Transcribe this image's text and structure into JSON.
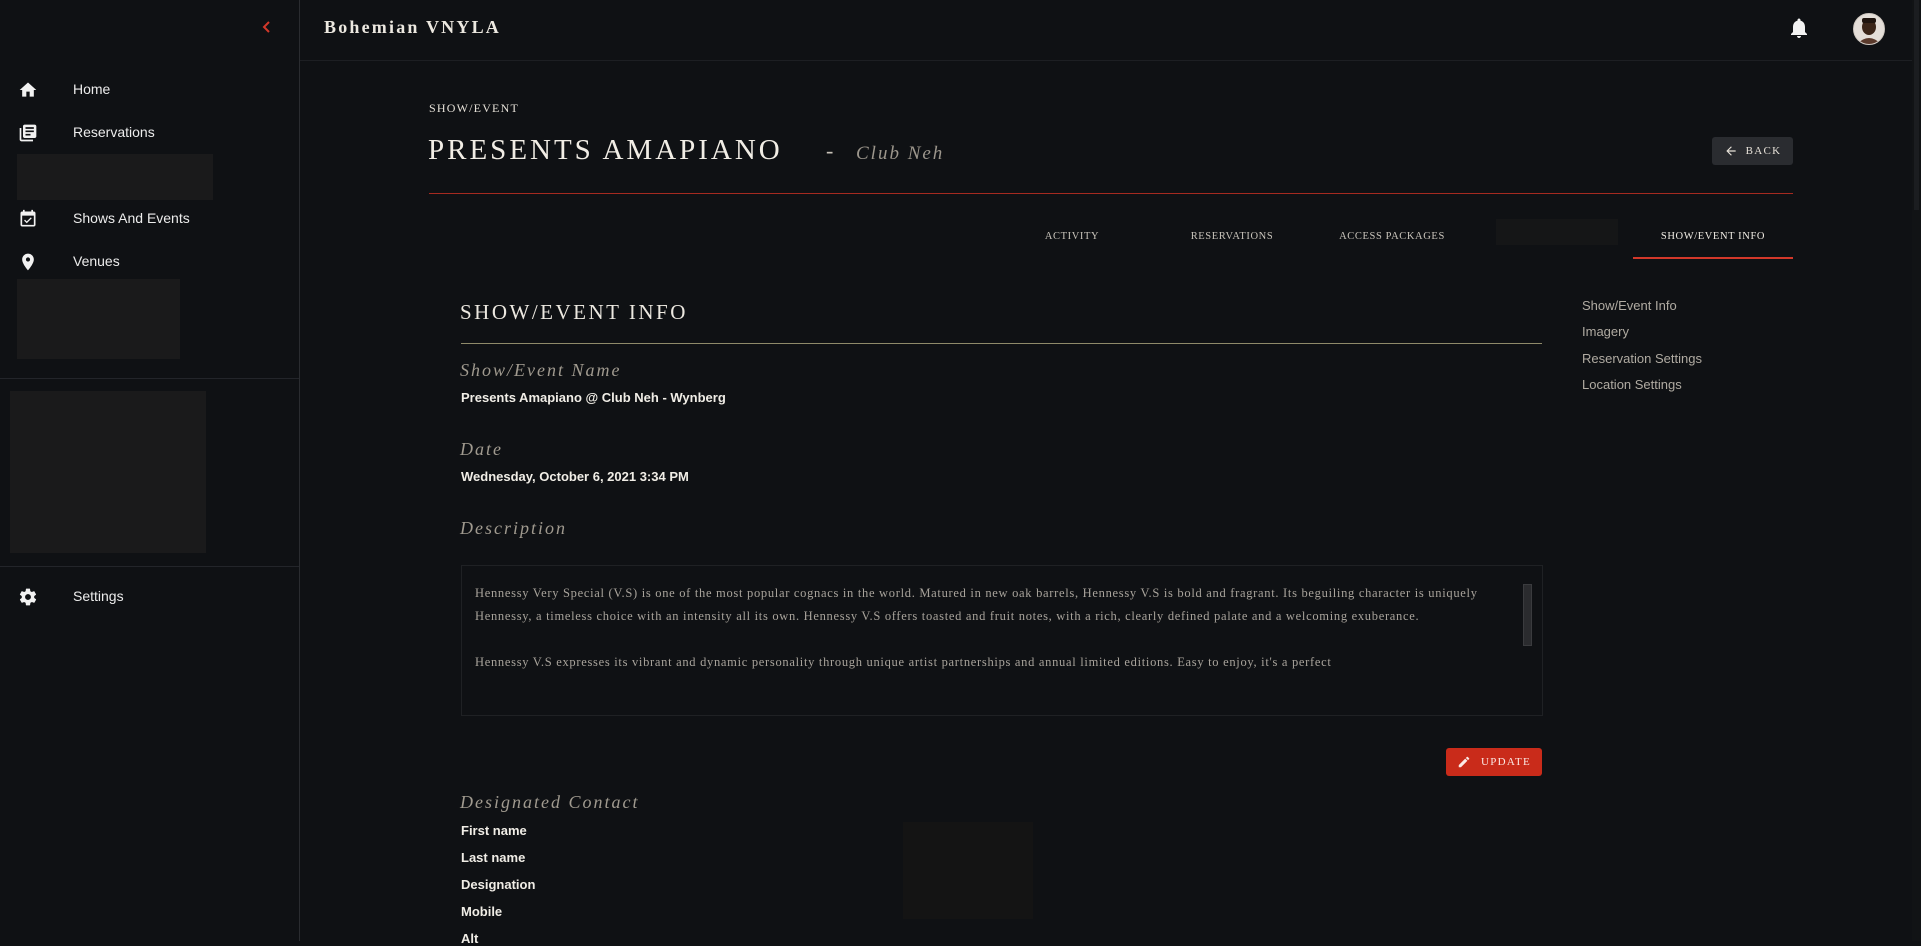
{
  "app": {
    "title": "Bohemian VNYLA"
  },
  "sidebar": {
    "items": [
      {
        "label": "Home",
        "icon": "home-icon"
      },
      {
        "label": "Reservations",
        "icon": "library-icon"
      },
      {
        "label": "Shows And Events",
        "icon": "calendar-check-icon"
      },
      {
        "label": "Venues",
        "icon": "map-pin-icon"
      },
      {
        "label": "Settings",
        "icon": "gear-icon"
      }
    ]
  },
  "header": {
    "kicker": "SHOW/EVENT",
    "title": "PRESENTS AMAPIANO",
    "dash": "-",
    "venue": "Club Neh",
    "back_label": "BACK"
  },
  "tabs": [
    {
      "label": "ACTIVITY"
    },
    {
      "label": "RESERVATIONS"
    },
    {
      "label": "ACCESS PACKAGES"
    },
    {
      "label": "SHOW/EVENT INFO",
      "active": true
    }
  ],
  "section": {
    "title": "SHOW/EVENT INFO",
    "name_label": "Show/Event Name",
    "name_value": "Presents Amapiano @ Club Neh - Wynberg",
    "date_label": "Date",
    "date_value": "Wednesday, October 6, 2021 3:34 PM",
    "description_label": "Description",
    "description_p1": "Hennessy Very Special (V.S) is one of the most popular cognacs in the world. Matured in new oak barrels, Hennessy V.S is bold and fragrant. Its beguiling character is uniquely Hennessy, a timeless choice with an intensity all its own. Hennessy V.S offers toasted and fruit notes, with a rich, clearly defined palate and a welcoming exuberance.",
    "description_p2": "Hennessy V.S expresses its vibrant and dynamic personality through unique artist partnerships and annual limited editions. Easy to enjoy, it's a perfect",
    "update_label": "UPDATE",
    "contact_label": "Designated Contact",
    "contact_fields": [
      "First name",
      "Last name",
      "Designation",
      "Mobile",
      "Alt"
    ]
  },
  "side_nav": [
    "Show/Event Info",
    "Imagery",
    "Reservation Settings",
    "Location Settings"
  ],
  "colors": {
    "accent": "#d2382a",
    "button_red": "#c92b1a",
    "background": "#0f1114"
  }
}
